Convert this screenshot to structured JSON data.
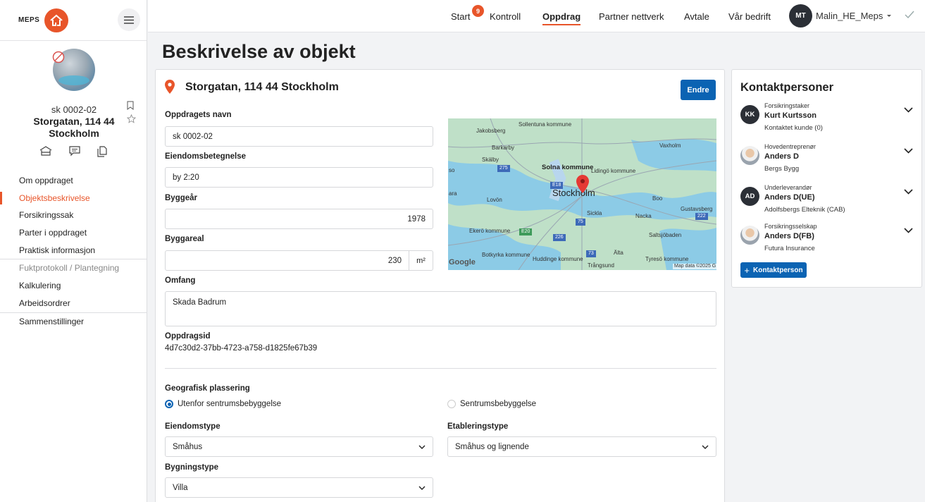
{
  "brand": {
    "name": "MEPS",
    "accent": "#e8552a",
    "primary": "#0b63b3"
  },
  "sidebar": {
    "case_id": "sk 0002-02",
    "case_address": "Storgatan, 114 44 Stockholm",
    "items": [
      {
        "label": "Om oppdraget"
      },
      {
        "label": "Objektsbeskrivelse",
        "active": true
      },
      {
        "label": "Forsikringssak"
      },
      {
        "label": "Parter i oppdraget"
      },
      {
        "label": "Praktisk informasjon"
      },
      {
        "label": "Fuktprotokoll / Plantegning"
      },
      {
        "label": "Kalkulering"
      },
      {
        "label": "Arbeidsordrer"
      },
      {
        "label": "Sammenstillinger"
      }
    ]
  },
  "topbar": {
    "nav": [
      {
        "label": "Start"
      },
      {
        "label": "Kontroll"
      },
      {
        "label": "Oppdrag",
        "active": true
      },
      {
        "label": "Partner nettverk"
      },
      {
        "label": "Avtale"
      },
      {
        "label": "Vår bedrift"
      }
    ],
    "start_badge": "9",
    "user_initials": "MT",
    "user_name": "Malin_HE_Meps"
  },
  "page": {
    "title": "Beskrivelse av objekt"
  },
  "object": {
    "address": "Storgatan, 114 44 Stockholm",
    "edit_label": "Endre",
    "name_label": "Oppdragets navn",
    "name_value": "sk 0002-02",
    "property_label": "Eiendomsbetegnelse",
    "property_value": "by 2:20",
    "year_label": "Byggeår",
    "year_value": "1978",
    "area_label": "Byggareal",
    "area_value": "230",
    "area_unit": "m²",
    "scope_label": "Omfang",
    "scope_value": "Skada Badrum",
    "id_label": "Oppdragsid",
    "id_value": "4d7c30d2-37bb-4723-a758-d1825fe67b39",
    "geo_label": "Geografisk plassering",
    "geo_options": [
      {
        "label": "Utenfor sentrumsbebyggelse",
        "selected": true
      },
      {
        "label": "Sentrumsbebyggelse",
        "selected": false
      }
    ],
    "property_type_label": "Eiendomstype",
    "property_type_value": "Småhus",
    "establish_type_label": "Etableringstype",
    "establish_type_value": "Småhus og lignende",
    "building_type_label": "Bygningstype",
    "building_type_value": "Villa"
  },
  "map": {
    "labels": {
      "sollentuna": "Sollentuna kommune",
      "jakobsberg": "Jakobsberg",
      "barkarby": "Barkarby",
      "skalby": "Skälby",
      "solna": "Solna kommune",
      "lidingo": "Lidingö kommune",
      "vaxholm": "Vaxholm",
      "stockholm": "Stockholm",
      "lovon": "Lovön",
      "boo": "Boo",
      "gustavsberg": "Gustavsberg",
      "sickla": "Sickla",
      "nacka": "Nacka",
      "ekero": "Ekerö kommune",
      "saltsjobaden": "Saltsjöbaden",
      "botkyrka": "Botkyrka kommune",
      "huddinge": "Huddinge kommune",
      "alta": "Älta",
      "tyreso": "Tyresö kommune",
      "trangsund": "Trångsund",
      "so": "so",
      "ara": "ara",
      "google": "Google",
      "attribution": "Map data ©2025 G",
      "r275": "275",
      "e18": "E18",
      "e20": "E20",
      "r226": "226",
      "r73": "73",
      "r75": "75",
      "r222": "222"
    }
  },
  "contacts": {
    "title": "Kontaktpersoner",
    "add_label": "Kontaktperson",
    "items": [
      {
        "initials": "KK",
        "role": "Forsikringstaker",
        "name": "Kurt Kurtsson",
        "sub": "Kontaktet kunde (0)"
      },
      {
        "photo": true,
        "role": "Hovedentreprenør",
        "name": "Anders D",
        "sub": "Bergs Bygg"
      },
      {
        "initials": "AD",
        "role": "Underleverandør",
        "name": "Anders D(UE)",
        "sub": "Adolfsbergs Elteknik (CAB)"
      },
      {
        "photo": true,
        "role": "Forsikringsselskap",
        "name": "Anders D(FB)",
        "sub": "Futura Insurance"
      }
    ]
  }
}
